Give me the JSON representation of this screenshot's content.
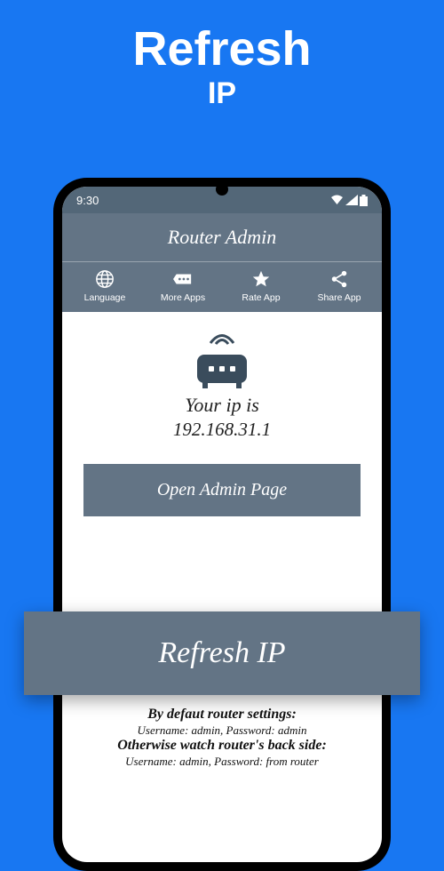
{
  "hero": {
    "line1": "Refresh",
    "line2": "IP"
  },
  "statusbar": {
    "time": "9:30"
  },
  "appbar": {
    "title": "Router Admin"
  },
  "toolbar": {
    "language": "Language",
    "more_apps": "More Apps",
    "rate_app": "Rate App",
    "share_app": "Share App"
  },
  "ip": {
    "label": "Your ip is",
    "value": "192.168.31.1"
  },
  "buttons": {
    "open_admin": "Open Admin Page",
    "refresh_ip": "Refresh IP"
  },
  "settings": {
    "default_title": "By defaut router settings:",
    "default_creds": "Username: admin, Password: admin",
    "otherwise_title": "Otherwise watch router's back side:",
    "otherwise_creds": "Username: admin, Password: from router"
  }
}
